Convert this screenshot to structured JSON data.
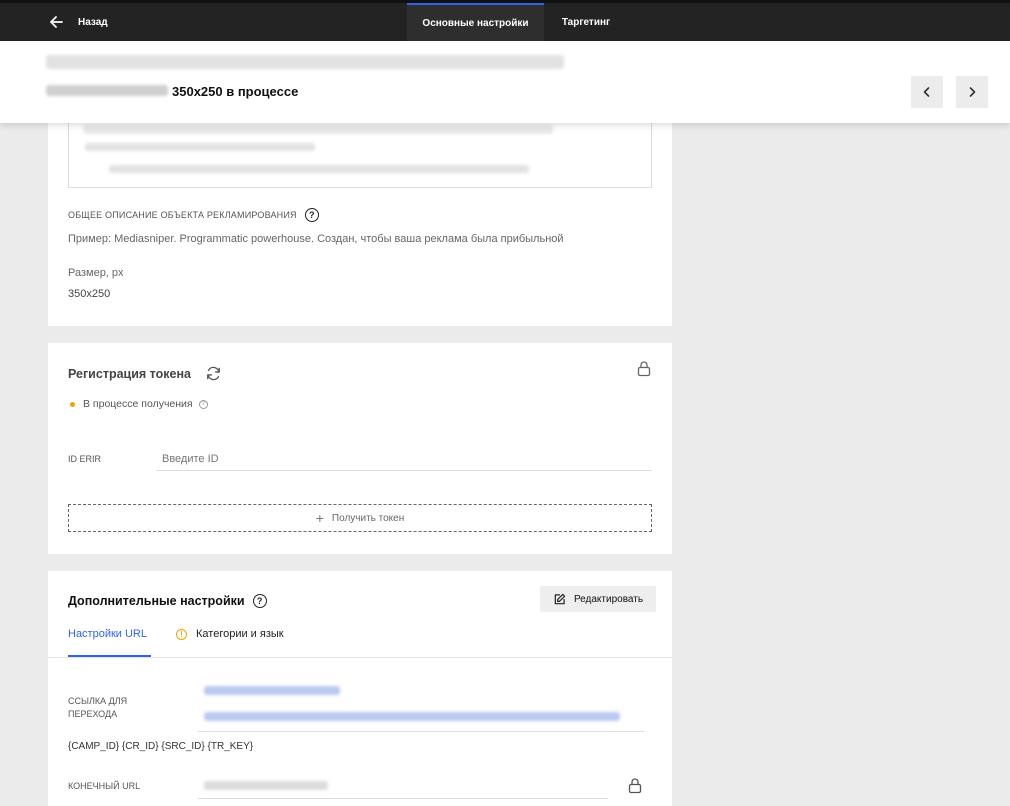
{
  "nav": {
    "back_label": "Назад",
    "tabs": [
      {
        "label": "Основные настройки",
        "active": true
      },
      {
        "label": "Таргетинг",
        "active": false
      }
    ]
  },
  "header": {
    "title": "350x250 в процессе"
  },
  "general": {
    "description_label": "ОБЩЕЕ ОПИСАНИЕ ОБЪЕКТА РЕКЛАМИРОВАНИЯ",
    "description_value": "Пример: Mediasniper. Programmatic powerhouse. Создан, чтобы ваша реклама была прибыльной",
    "size_label": "Размер, px",
    "size_value": "350x250"
  },
  "token": {
    "title": "Регистрация токена",
    "status": "В процессе получения",
    "status_color": "#f0a500",
    "id_label": "ID ERIR",
    "id_placeholder": "Введите ID",
    "id_value": "",
    "get_token_label": "Получить токен"
  },
  "additional": {
    "title": "Дополнительные настройки",
    "edit_label": "Редактировать",
    "tabs": [
      {
        "label": "Настройки URL",
        "active": true
      },
      {
        "label": "Категории и язык",
        "active": false,
        "warning": true
      }
    ],
    "link_label_line1": "ССЫЛКА ДЛЯ",
    "link_label_line2": "ПЕРЕХОДА",
    "macros": "{CAMP_ID} {CR_ID} {SRC_ID} {TR_KEY}",
    "final_url_label": "КОНЕЧНЫЙ URL"
  },
  "colors": {
    "accent": "#2f63e7",
    "nav_bg": "#232323",
    "warning": "#f0a500"
  }
}
